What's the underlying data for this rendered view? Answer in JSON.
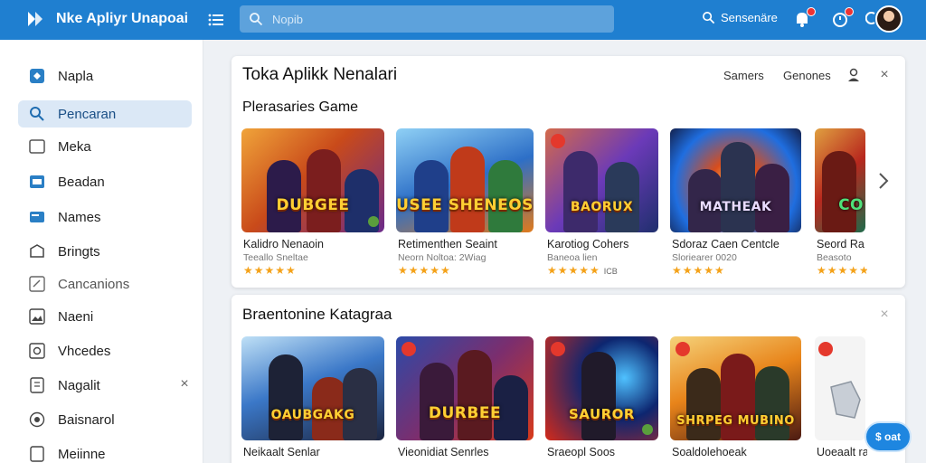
{
  "header": {
    "app_title": "Nke Apliyr Unapoai",
    "search_placeholder": "Nopib",
    "search_link": "Sensenäre",
    "icons": [
      "logo-icon",
      "menu-icon",
      "search-icon",
      "notification-icon",
      "alarm-icon",
      "chat-icon"
    ]
  },
  "sidebar": {
    "items": [
      {
        "label": "Napla",
        "icon": "tag-icon",
        "active": false
      },
      {
        "label": "Pencaran",
        "icon": "search-icon",
        "active": true
      },
      {
        "label": "Meka",
        "icon": "folder-icon",
        "active": false
      },
      {
        "label": "Beadan",
        "icon": "image-icon",
        "active": false
      },
      {
        "label": "Names",
        "icon": "card-icon",
        "active": false
      },
      {
        "label": "Bringts",
        "icon": "box-icon",
        "active": false
      },
      {
        "label": "Cancanions",
        "icon": "edit-icon",
        "active": false
      },
      {
        "label": "Naeni",
        "icon": "gallery-icon",
        "active": false
      },
      {
        "label": "Vhcedes",
        "icon": "camera-icon",
        "active": false
      },
      {
        "label": "Nagalit",
        "icon": "document-icon",
        "active": false,
        "closable": true
      },
      {
        "label": "Baisnarol",
        "icon": "clock-icon",
        "active": false
      },
      {
        "label": "Meiinne",
        "icon": "file-icon",
        "active": false
      }
    ]
  },
  "panel1": {
    "title": "Toka Aplikk Nenalari",
    "subtitle": "Plerasaries Game",
    "tabs": [
      "Samers",
      "Genones"
    ],
    "cards": [
      {
        "name": "Kalidro Nenaoin",
        "meta": "Teeallo Sneltae",
        "rating": "★★★★★",
        "art_text": "DUBGEE",
        "colors": [
          "#c94a1a",
          "#6a2a8a"
        ]
      },
      {
        "name": "Retimenthen Seaint",
        "meta": "Neorn Noltoa: 2Wiag",
        "rating": "★★★★★",
        "art_text": "USEE SHENEOS",
        "colors": [
          "#2d6fc7",
          "#e07a1c"
        ]
      },
      {
        "name": "Karotiog Cohers",
        "meta": "Baneoa lien",
        "rating": "★★★★★",
        "rating_note": "ICB",
        "art_text": "BAORUX",
        "colors": [
          "#6b3ab8",
          "#1f2f6d"
        ]
      },
      {
        "name": "Sdoraz Caen Centcle",
        "meta": "Sloriearer 0020",
        "rating": "★★★★★",
        "art_text": "MATHEAK",
        "colors": [
          "#1f6ee0",
          "#d84d1c"
        ]
      },
      {
        "name": "Seord Ra",
        "meta": "Beasoto",
        "rating": "★★★★★",
        "art_text": "CO",
        "colors": [
          "#b8281e",
          "#1d6a4a"
        ]
      }
    ]
  },
  "panel2": {
    "title": "Braentonine Katagraa",
    "cards": [
      {
        "name": "Neikaalt Senlar",
        "art_text": "OAUBGAKG",
        "colors": [
          "#3b78c8",
          "#1c2540"
        ]
      },
      {
        "name": "Vieonidiat Senrles",
        "art_text": "DURBEE",
        "colors": [
          "#7b2e6e",
          "#2c4aa8"
        ]
      },
      {
        "name": "Sraeopl Soos",
        "art_text": "SAUROR",
        "colors": [
          "#d42a1a",
          "#0d2670"
        ]
      },
      {
        "name": "Soaldolehoeak",
        "art_text": "SHRPEG MUBINO",
        "colors": [
          "#e8841a",
          "#4b1a12"
        ]
      },
      {
        "name": "Uoeaalt ral",
        "art_text": "",
        "colors": [
          "#f3f3f3",
          "#d8dde2"
        ]
      }
    ],
    "fab_label": "$ oat"
  }
}
